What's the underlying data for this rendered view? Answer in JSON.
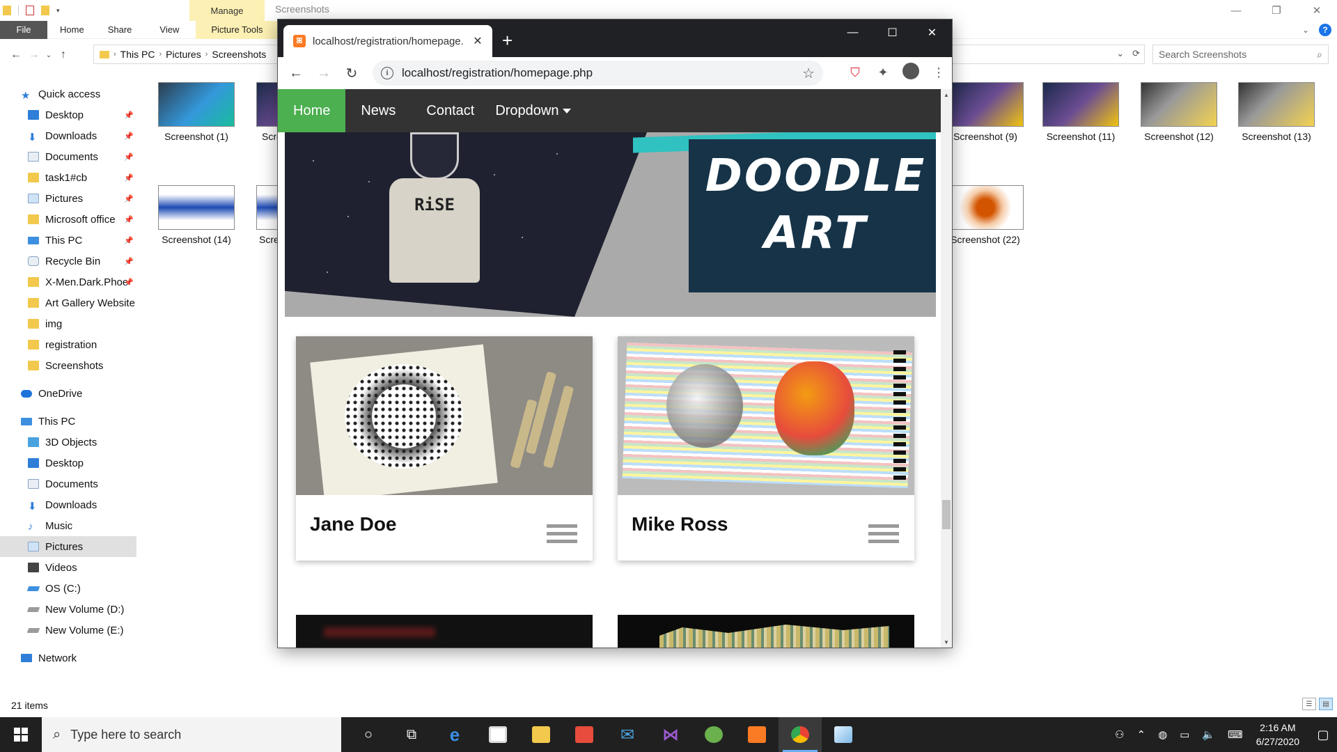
{
  "explorer": {
    "title": "Screenshots",
    "context_tab": "Manage",
    "ribbon_tabs": [
      "File",
      "Home",
      "Share",
      "View",
      "Picture Tools"
    ],
    "breadcrumb": [
      "This PC",
      "Pictures",
      "Screenshots"
    ],
    "search_placeholder": "Search Screenshots",
    "nav_quick_access": "Quick access",
    "nav_pinned": [
      {
        "label": "Desktop",
        "icon": "desktop-icon"
      },
      {
        "label": "Downloads",
        "icon": "download-icon"
      },
      {
        "label": "Documents",
        "icon": "document-icon"
      },
      {
        "label": "task1#cb",
        "icon": "folder-icon"
      },
      {
        "label": "Pictures",
        "icon": "pictures-icon"
      },
      {
        "label": "Microsoft office",
        "icon": "folder-icon"
      },
      {
        "label": "This PC",
        "icon": "pc-icon"
      },
      {
        "label": "Recycle Bin",
        "icon": "recycle-icon"
      },
      {
        "label": "X-Men.Dark.Phoe",
        "icon": "folder-icon"
      }
    ],
    "nav_folders": [
      "Art Gallery Website",
      "img",
      "registration",
      "Screenshots"
    ],
    "nav_onedrive": "OneDrive",
    "nav_thispc": "This PC",
    "nav_pc_items": [
      {
        "label": "3D Objects",
        "icon": "cube-icon"
      },
      {
        "label": "Desktop",
        "icon": "desktop-icon"
      },
      {
        "label": "Documents",
        "icon": "document-icon"
      },
      {
        "label": "Downloads",
        "icon": "download-icon"
      },
      {
        "label": "Music",
        "icon": "music-icon"
      },
      {
        "label": "Pictures",
        "icon": "pictures-icon"
      },
      {
        "label": "Videos",
        "icon": "video-icon"
      },
      {
        "label": "OS (C:)",
        "icon": "drive-icon"
      },
      {
        "label": "New Volume (D:)",
        "icon": "drive-icon"
      },
      {
        "label": "New Volume (E:)",
        "icon": "drive-icon"
      }
    ],
    "nav_network": "Network",
    "selected_nav": "Pictures",
    "files_row1": [
      "Screenshot (1)",
      "Scre",
      "Screenshot (9)",
      "Screenshot (11)",
      "Screenshot (12)",
      "Screenshot (13)"
    ],
    "files_row2": [
      "Screenshot (14)",
      "Scre",
      "Screenshot (22)"
    ],
    "status": "21 items"
  },
  "browser": {
    "tab_title": "localhost/registration/homepage.php",
    "url": "localhost/registration/homepage.php",
    "page": {
      "nav": [
        "Home",
        "News",
        "Contact",
        "Dropdown"
      ],
      "active_nav": "Home",
      "hero_text_line1": "DOODLE",
      "hero_text_line2": "ART",
      "hero_shirt_text": "RiSE",
      "cards": [
        {
          "name": "Jane Doe"
        },
        {
          "name": "Mike Ross"
        }
      ]
    }
  },
  "taskbar": {
    "search_placeholder": "Type here to search",
    "time": "2:16 AM",
    "date": "6/27/2020",
    "accent_color": "#6ab0f3"
  }
}
